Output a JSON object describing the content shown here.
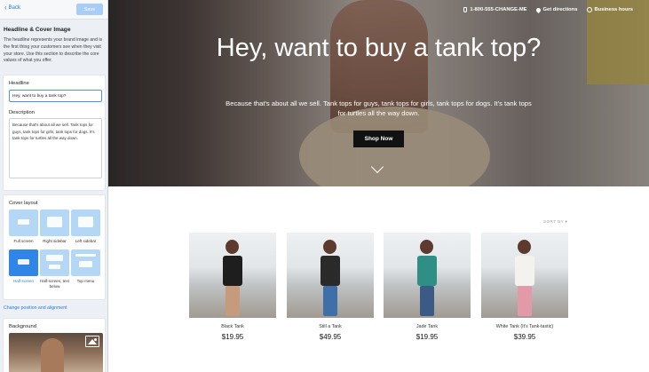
{
  "sidebar": {
    "back_label": "Back",
    "save_label": "Save",
    "section_title": "Headline & Cover Image",
    "section_description": "The headline represents your brand image and is the first thing your customers see when they visit your store. Use this section to describe the core values of what you offer.",
    "headline": {
      "label": "Headline",
      "value": "Hey, want to buy a tank top?"
    },
    "description": {
      "label": "Description",
      "value": "Because that's about all we sell. Tank tops for guys, tank tops for girls, tank tops for dogs. It's tank tops for turtles all the way down."
    },
    "cover_layout": {
      "label": "Cover layout",
      "options": [
        {
          "label": "Full screen",
          "selected": false
        },
        {
          "label": "Right sidebar",
          "selected": false
        },
        {
          "label": "Left sidebar",
          "selected": false
        },
        {
          "label": "Half-screen",
          "selected": true
        },
        {
          "label": "Half-screen, text below",
          "selected": false
        },
        {
          "label": "Top menu",
          "selected": false
        }
      ]
    },
    "change_link": "Change position and alignment",
    "background": {
      "label": "Background",
      "icon": "image-icon"
    }
  },
  "hero": {
    "nav": {
      "phone": "1-800-555-CHANGE-ME",
      "directions": "Get directions",
      "hours": "Business hours"
    },
    "title": "Hey, want to buy a tank top?",
    "subtitle": "Because that's about all we sell. Tank tops for guys, tank tops for girls, tank tops for dogs. It's tank tops for turtles all the way down.",
    "cta": "Shop Now"
  },
  "products": {
    "sort_label": "SORT BY ▾",
    "items": [
      {
        "name": "Black Tank",
        "price": "$19.95",
        "top_color": "#1e1e1e"
      },
      {
        "name": "Still a Tank",
        "price": "$49.95",
        "top_color": "#2a2a2a"
      },
      {
        "name": "Jade Tank",
        "price": "$19.95",
        "top_color": "#2f8f86"
      },
      {
        "name": "White Tank (It's Tank-tastic)",
        "price": "$39.95",
        "top_color": "#f4f2ee"
      }
    ]
  },
  "colors": {
    "accent": "#2d7be5",
    "selected_layout": "#2f86e6",
    "layout_thumb": "#b5d7f6",
    "button_dark": "#111111"
  }
}
